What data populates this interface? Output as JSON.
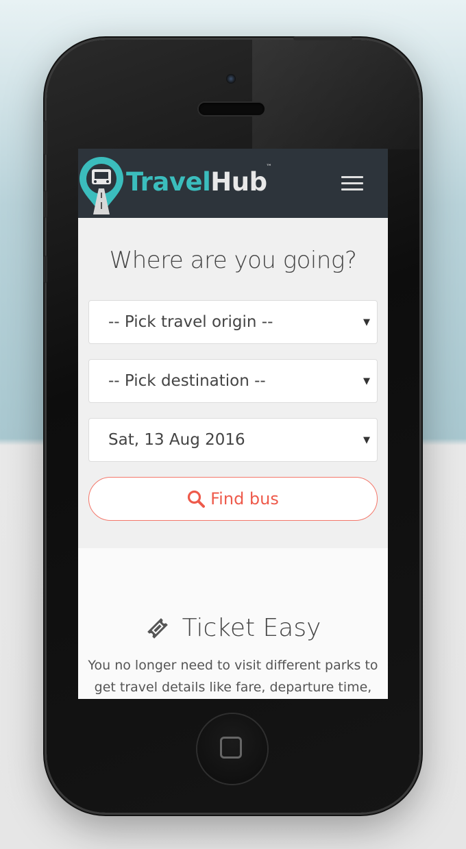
{
  "app": {
    "brand_first": "Travel",
    "brand_second": "Hub",
    "trademark": "™"
  },
  "search": {
    "heading": "Where are you going?",
    "origin_value": "-- Pick travel origin --",
    "destination_value": "-- Pick destination --",
    "date_value": "Sat, 13 Aug 2016",
    "dropdown_arrow": "▼",
    "find_button_label": "Find bus"
  },
  "features": {
    "title": "Ticket Easy",
    "text": "You no longer need to visit different parks to get travel details like fare, departure time,"
  },
  "icons": {
    "logo": "bus-pin-logo-icon",
    "menu": "hamburger-menu-icon",
    "search": "search-icon",
    "ticket": "ticket-icon"
  },
  "colors": {
    "navbar": "#2d343b",
    "brand_teal": "#3bbdbd",
    "accent_red": "#ee5a4b"
  }
}
